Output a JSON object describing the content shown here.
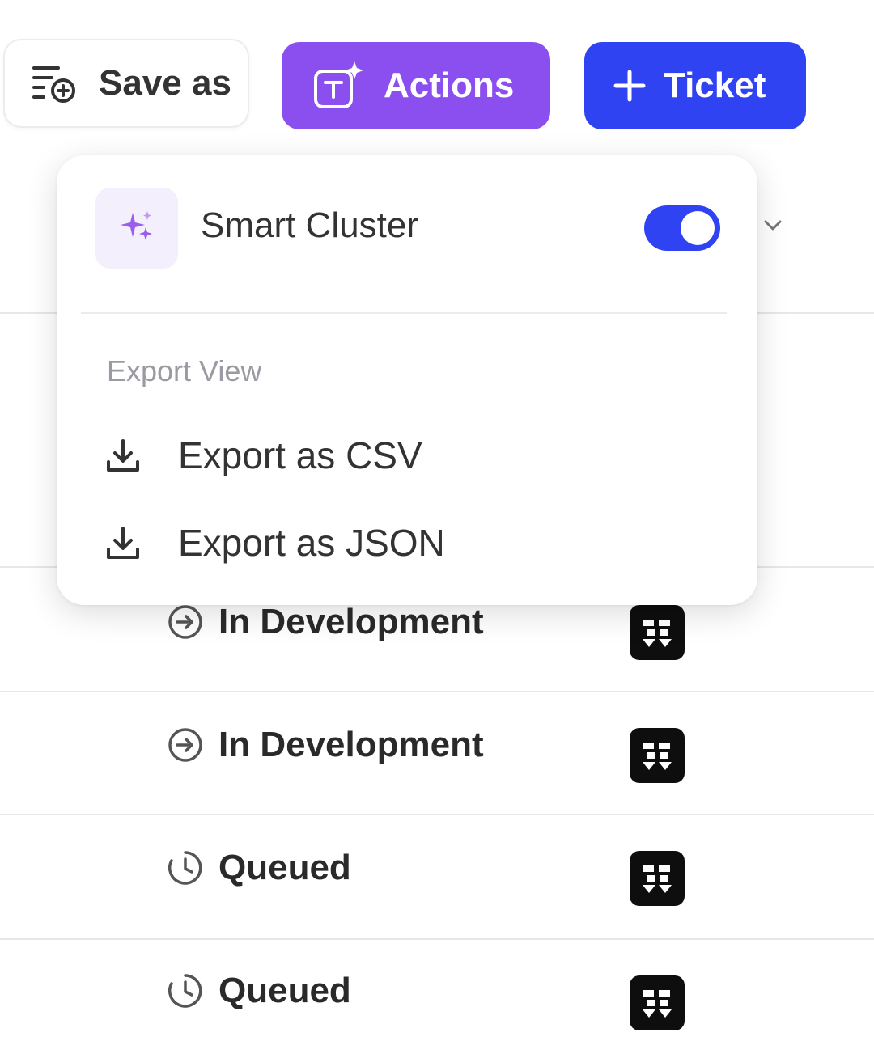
{
  "toolbar": {
    "save_label": "Save as",
    "actions_label": "Actions",
    "ticket_label": "Ticket"
  },
  "menu": {
    "smart_cluster_label": "Smart Cluster",
    "smart_cluster_enabled": true,
    "export_section_title": "Export View",
    "items": [
      {
        "label": "Export as CSV",
        "icon": "download-icon"
      },
      {
        "label": "Export as JSON",
        "icon": "download-icon"
      }
    ]
  },
  "rows": [
    {
      "status": "In Development",
      "icon": "status-arrow-icon"
    },
    {
      "status": "In Development",
      "icon": "status-arrow-icon"
    },
    {
      "status": "Queued",
      "icon": "clock-icon"
    },
    {
      "status": "Queued",
      "icon": "clock-icon"
    }
  ],
  "colors": {
    "actions": "#8b4ff0",
    "ticket": "#2f43f2",
    "toggle_on": "#2f43f2",
    "smart_cluster_badge": "#f4effd"
  }
}
